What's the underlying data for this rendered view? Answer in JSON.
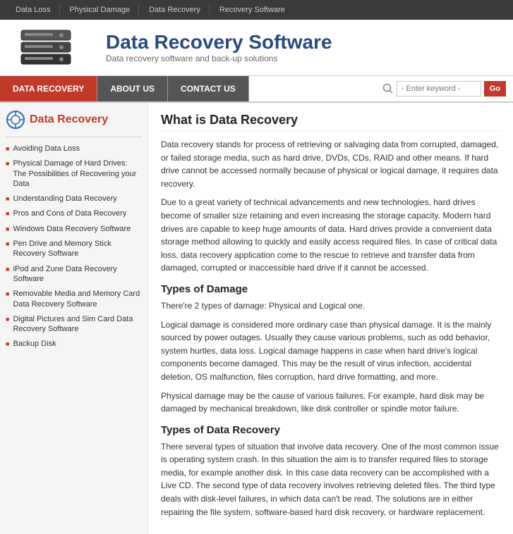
{
  "topnav": {
    "items": [
      "Data Loss",
      "Physical Damage",
      "Data Recovery",
      "Recovery Software"
    ]
  },
  "header": {
    "title": "Data Recovery Software",
    "subtitle": "Data recovery software and back-up solutions"
  },
  "secnav": {
    "items": [
      {
        "label": "DATA RECOVERY",
        "active": true
      },
      {
        "label": "ABOUT US",
        "active": false
      },
      {
        "label": "CONTACT US",
        "active": false
      }
    ],
    "search_placeholder": "- Enter keyword -",
    "search_btn": "Go"
  },
  "sidebar": {
    "title": "Data Recovery",
    "links": [
      "Avoiding Data Loss",
      "Physical Damage of Hard Drives: The Possibilities of Recovering your Data",
      "Understanding Data Recovery",
      "Pros and Cons of Data Recovery",
      "Windows Data Recovery Software",
      "Pen Drive and Memory Stick Recovery Software",
      "iPod and Zune Data Recovery Software",
      "Removable Media and Memory Card Data Recovery Software",
      "Digital Pictures and Sim Card Data Recovery Software",
      "Backup Disk"
    ]
  },
  "content": {
    "main_heading": "What is Data Recovery",
    "paragraphs": [
      "Data recovery stands for process of retrieving or salvaging data from corrupted, damaged, or failed storage media, such as hard drive, DVDs, CDs, RAID and other means. If hard drive cannot be accessed normally because of physical or logical damage, it requires data recovery.",
      "Due to a great variety of technical advancements and new technologies, hard drives become of smaller size retaining and even increasing the storage capacity. Modern hard drives are capable to keep huge amounts of data. Hard drives provide a convenient data storage method allowing to quickly and easily access required files. In case of critical data loss, data recovery application come to the rescue to retrieve and transfer data from damaged, corrupted or inaccessible hard drive if it cannot be accessed."
    ],
    "section1_heading": "Types of Damage",
    "section1_paragraphs": [
      "There're 2 types of damage: Physical and Logical one.",
      "Logical damage is considered more ordinary case than physical damage. It is the mainly sourced by power outages. Usually they cause various problems, such as odd behavior, system hurtles, data loss. Logical damage happens in case when hard drive's logical components become damaged. This may be the result of virus infection, accidental deletion, OS malfunction, files corruption, hard drive formatting, and more.",
      "Physical damage may be the cause of various failures. For example, hard disk may be damaged by mechanical breakdown, like disk controller or spindle motor failure."
    ],
    "section2_heading": "Types of Data Recovery",
    "section2_paragraphs": [
      "There several types of situation that involve data recovery. One of the most common issue is operating system crash. In this situation the aim is to transfer required files to storage media, for example another disk. In this case data recovery can be accomplished with a Live CD. The second type of data recovery involves retrieving deleted files. The third type deals with disk-level failures, in which data can't be read. The solutions are in either repairing the file system, software-based hard disk recovery, or hardware replacement."
    ]
  }
}
